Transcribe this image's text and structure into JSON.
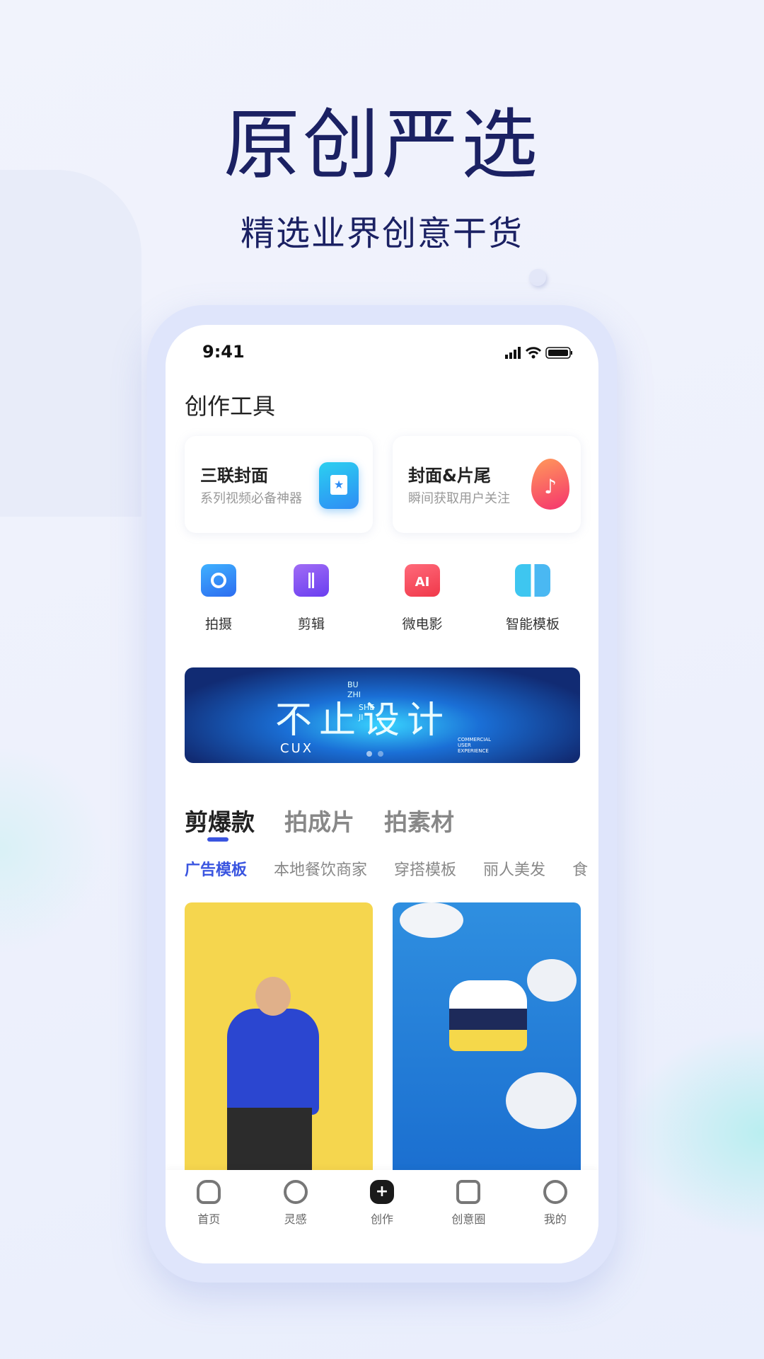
{
  "hero": {
    "title": "原创严选",
    "subtitle": "精选业界创意干货"
  },
  "status_bar": {
    "time": "9:41"
  },
  "section_title": "创作工具",
  "cards": [
    {
      "title": "三联封面",
      "subtitle": "系列视频必备神器",
      "icon": "triptych-cover-icon"
    },
    {
      "title": "封面&片尾",
      "subtitle": "瞬间获取用户关注",
      "icon": "flame-tiktok-icon"
    }
  ],
  "tools": [
    {
      "label": "拍摄",
      "icon": "camera-icon"
    },
    {
      "label": "剪辑",
      "icon": "edit-clip-icon"
    },
    {
      "label": "微电影",
      "icon": "ai-movie-icon"
    },
    {
      "label": "智能模板",
      "icon": "smart-template-icon"
    }
  ],
  "banner": {
    "text": "不止设计",
    "pinyin": [
      "BU",
      "ZHI",
      "SHE",
      "JI"
    ],
    "logo": "CUX",
    "tagline": "COMMERCIAL USER EXPERIENCE"
  },
  "tabs": [
    {
      "label": "剪爆款",
      "active": true
    },
    {
      "label": "拍成片"
    },
    {
      "label": "拍素材"
    }
  ],
  "subtabs": [
    {
      "label": "广告模板",
      "active": true
    },
    {
      "label": "本地餐饮商家"
    },
    {
      "label": "穿搭模板"
    },
    {
      "label": "丽人美发"
    },
    {
      "label": "食"
    }
  ],
  "nav": [
    {
      "label": "首页",
      "icon": "home-icon"
    },
    {
      "label": "灵感",
      "icon": "compass-icon"
    },
    {
      "label": "创作",
      "icon": "plus-icon"
    },
    {
      "label": "创意圈",
      "icon": "chat-icon"
    },
    {
      "label": "我的",
      "icon": "face-icon"
    }
  ],
  "colors": {
    "accent": "#3a55e0",
    "title": "#1b2163"
  }
}
